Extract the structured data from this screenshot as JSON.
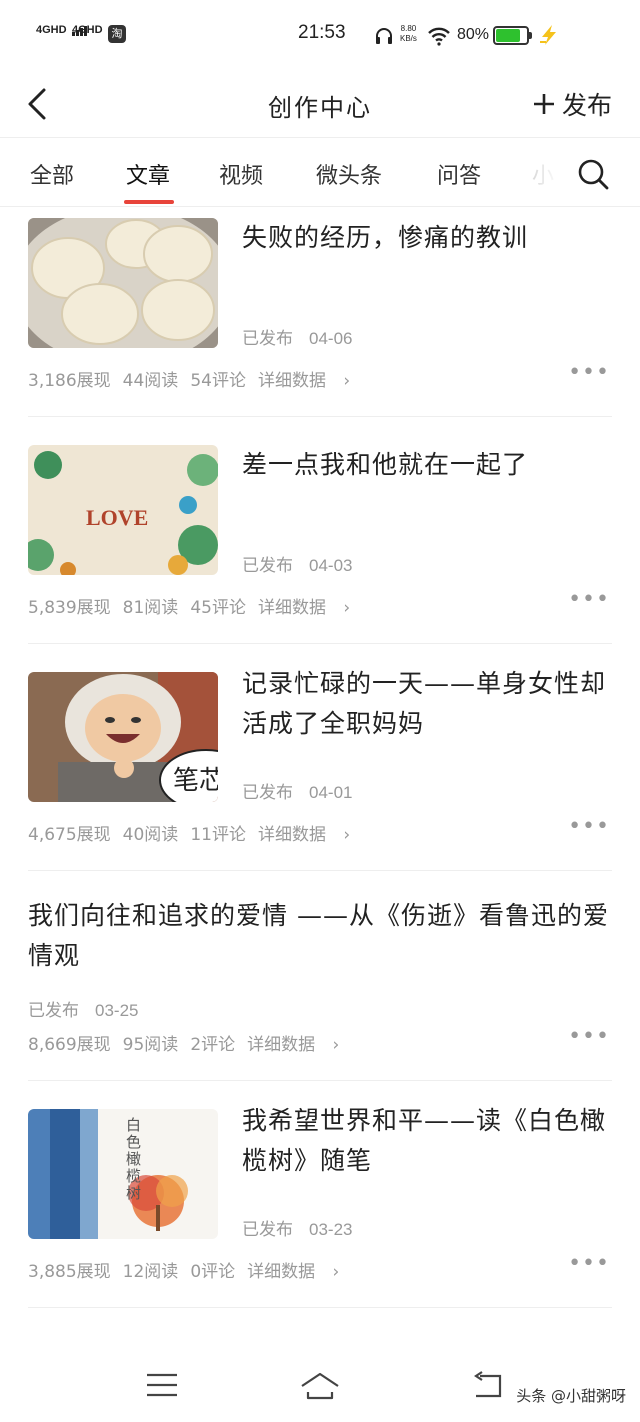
{
  "status_bar": {
    "network1": "4GHD",
    "network2": "4GHD",
    "app_icon": "淘",
    "time": "21:53",
    "speed_value": "8.80",
    "speed_unit": "KB/s",
    "battery": "80%",
    "battery_level": 0.8,
    "icons": [
      "headphones-icon",
      "wifi-icon",
      "battery-icon",
      "charging-bolt-icon"
    ]
  },
  "header": {
    "title": "创作中心",
    "publish_label": "发布",
    "publish_icon": "plus-icon",
    "back_icon": "back-arrow-icon"
  },
  "tabs": [
    {
      "label": "全部"
    },
    {
      "label": "文章",
      "active": true
    },
    {
      "label": "视频"
    },
    {
      "label": "微头条"
    },
    {
      "label": "问答"
    },
    {
      "label": "小"
    }
  ],
  "accent_color": "#e8443a",
  "articles": [
    {
      "title": "失败的经历，惨痛的教训",
      "status": "已发布",
      "date": "04-06",
      "impressions": "3,186展现",
      "reads": "44阅读",
      "comments": "54评论",
      "detail": "详细数据",
      "thumbnail": "steamed-buns-photo"
    },
    {
      "title": "差一点我和他就在一起了",
      "status": "已发布",
      "date": "04-03",
      "impressions": "5,839展现",
      "reads": "81阅读",
      "comments": "45评论",
      "detail": "详细数据",
      "thumbnail": "love-quilling-photo"
    },
    {
      "title": "记录忙碌的一天——单身女性却活成了全职妈妈",
      "status": "已发布",
      "date": "04-01",
      "impressions": "4,675展现",
      "reads": "40阅读",
      "comments": "11评论",
      "detail": "详细数据",
      "thumbnail": "laughing-child-photo",
      "thumbnail_text": "笔芯"
    },
    {
      "title": "我们向往和追求的爱情 ——从《伤逝》看鲁迅的爱情观",
      "status": "已发布",
      "date": "03-25",
      "impressions": "8,669展现",
      "reads": "95阅读",
      "comments": "2评论",
      "detail": "详细数据"
    },
    {
      "title": "我希望世界和平——读《白色橄榄树》随笔",
      "status": "已发布",
      "date": "03-23",
      "impressions": "3,885展现",
      "reads": "12阅读",
      "comments": "0评论",
      "detail": "详细数据",
      "thumbnail": "book-cover-photo",
      "thumbnail_text": "白色橄榄树"
    }
  ],
  "bottom_nav": {
    "icons": [
      "menu-icon",
      "home-icon",
      "back-icon"
    ],
    "watermark": "头条 @小甜粥呀"
  }
}
